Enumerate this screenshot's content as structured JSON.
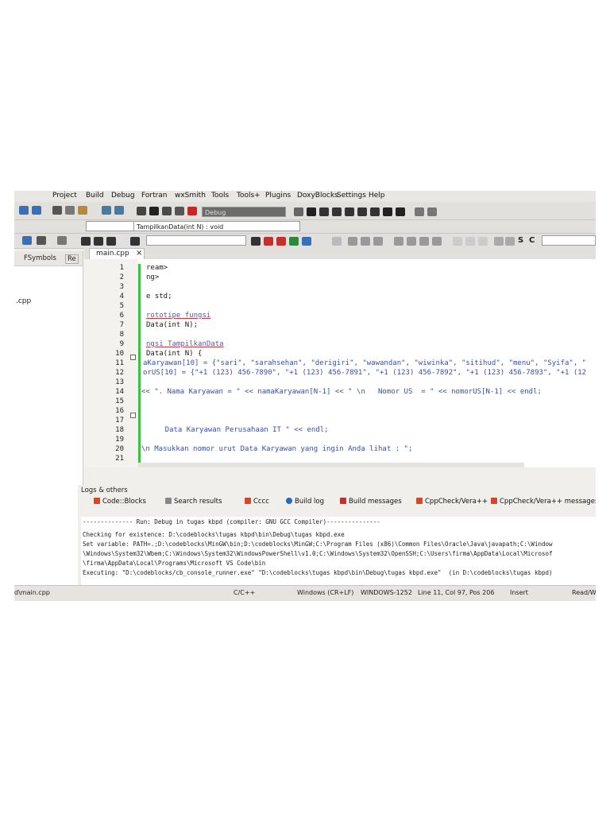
{
  "menubar": [
    "Project",
    "Build",
    "Debug",
    "Fortran",
    "wxSmith",
    "Tools",
    "Tools+",
    "Plugins",
    "DoxyBlocks",
    "Settings",
    "Help"
  ],
  "toolbar": {
    "build_target": "Debug",
    "function_combo": "TampilkanData(int N) : void",
    "search_combo": "",
    "symbol_glyphs": [
      "S",
      "C"
    ]
  },
  "left_panel": {
    "tab_symbols": "FSymbols",
    "tab_resources": "Re",
    "file_item": ".cpp"
  },
  "editor": {
    "tab_label": "main.cpp",
    "tab_close": "×",
    "lines": [
      {
        "n": "1",
        "text": "ream>"
      },
      {
        "n": "2",
        "text": "ng>"
      },
      {
        "n": "3",
        "text": ""
      },
      {
        "n": "4",
        "text": "e std;"
      },
      {
        "n": "5",
        "text": ""
      },
      {
        "n": "6",
        "text": "rototipe fungsi"
      },
      {
        "n": "7",
        "text": "Data(int N);"
      },
      {
        "n": "8",
        "text": ""
      },
      {
        "n": "9",
        "text": "ngsi TampilkanData"
      },
      {
        "n": "10",
        "text": "Data(int N) {"
      },
      {
        "n": "11",
        "text": "aKaryawan[10] = {\"sari\", \"sarahsehan\", \"derigiri\", \"wawandan\", \"wiwinka\", \"sitihud\", \"menu\", \"Syifa\", \""
      },
      {
        "n": "12",
        "text": "orUS[10] = {\"+1 (123) 456-7890\", \"+1 (123) 456-7891\", \"+1 (123) 456-7892\", \"+1 (123) 456-7893\", \"+1 (12"
      },
      {
        "n": "13",
        "text": ""
      },
      {
        "n": "14",
        "text": "<< \". Nama Karyawan = \" << namaKaryawan[N-1] << \" \\n   Nomor US  = \" << nomorUS[N-1] << endl;"
      },
      {
        "n": "15",
        "text": ""
      },
      {
        "n": "16",
        "text": ""
      },
      {
        "n": "17",
        "text": ""
      },
      {
        "n": "18",
        "text": "    Data Karyawan Perusahaan IT \" << endl;"
      },
      {
        "n": "19",
        "text": ""
      },
      {
        "n": "20",
        "text": "\\n Masukkan nomor urut Data Karyawan yang ingin Anda lihat : \";"
      },
      {
        "n": "21",
        "text": ""
      }
    ]
  },
  "logs": {
    "title": "Logs & others",
    "tabs": [
      "Code::Blocks",
      "Search results",
      "Cccc",
      "Build log",
      "Build messages",
      "CppCheck/Vera++",
      "CppCheck/Vera++ messages"
    ],
    "lines": [
      "-------------- Run: Debug in tugas kbpd (compiler: GNU GCC Compiler)---------------",
      "Checking for existence: D:\\codeblocks\\tugas kbpd\\bin\\Debug\\tugas kbpd.exe",
      "Set variable: PATH=.;D:\\codeblocks\\MinGW\\bin;D:\\codeblocks\\MinGW;C:\\Program Files (x86)\\Common Files\\Oracle\\Java\\javapath;C:\\Window",
      "\\Windows\\System32\\Wbem;C:\\Windows\\System32\\WindowsPowerShell\\v1.0;C:\\Windows\\System32\\OpenSSH;C:\\Users\\firma\\AppData\\Local\\Microsof",
      "\\firma\\AppData\\Local\\Programs\\Microsoft VS Code\\bin",
      "Executing: \"D:\\codeblocks/cb_console_runner.exe\" \"D:\\codeblocks\\tugas kbpd\\bin\\Debug\\tugas kbpd.exe\"  (in D:\\codeblocks\\tugas kbpd)"
    ]
  },
  "status": {
    "file": "d\\main.cpp",
    "language": "C/C++",
    "eol": "Windows (CR+LF)",
    "encoding": "WINDOWS-1252",
    "position": "Line 11, Col 97, Pos 206",
    "mode": "Insert",
    "rw": "Read/Wr"
  },
  "colors": {
    "change_bar": "#3fbf3f",
    "string": "#3a4fa0",
    "operator": "#b03030"
  }
}
